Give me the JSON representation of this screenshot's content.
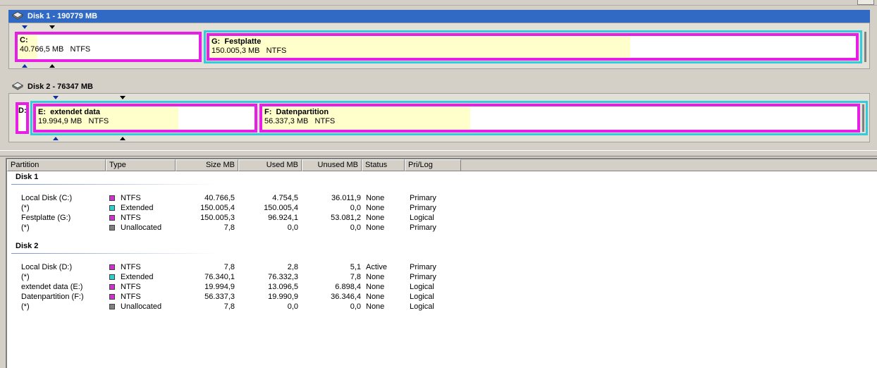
{
  "disks": [
    {
      "title": "Disk 1 - 190779 MB",
      "partitions": [
        {
          "letter": "C:",
          "name": "",
          "size": "40.766,5 MB",
          "fs": "NTFS"
        },
        {
          "letter": "G:",
          "name": "Festplatte",
          "size": "150.005,3 MB",
          "fs": "NTFS"
        }
      ]
    },
    {
      "title": "Disk 2 - 76347 MB",
      "partitions": [
        {
          "letter": "D:",
          "name": "",
          "size": "",
          "fs": ""
        },
        {
          "letter": "E:",
          "name": "extendet data",
          "size": "19.994,9 MB",
          "fs": "NTFS"
        },
        {
          "letter": "F:",
          "name": "Datenpartition",
          "size": "56.337,3 MB",
          "fs": "NTFS"
        }
      ]
    }
  ],
  "columns": [
    "Partition",
    "Type",
    "Size MB",
    "Used MB",
    "Unused MB",
    "Status",
    "Pri/Log"
  ],
  "groups": [
    {
      "title": "Disk 1",
      "rows": [
        {
          "partition": "Local Disk (C:)",
          "type": "NTFS",
          "color": "#cc33cc",
          "size": "40.766,5",
          "used": "4.754,5",
          "unused": "36.011,9",
          "status": "None",
          "prilog": "Primary"
        },
        {
          "partition": "(*)",
          "type": "Extended",
          "color": "#33cccc",
          "size": "150.005,4",
          "used": "150.005,4",
          "unused": "0,0",
          "status": "None",
          "prilog": "Primary"
        },
        {
          "partition": "Festplatte (G:)",
          "type": "NTFS",
          "color": "#cc33cc",
          "size": "150.005,3",
          "used": "96.924,1",
          "unused": "53.081,2",
          "status": "None",
          "prilog": "Logical"
        },
        {
          "partition": "(*)",
          "type": "Unallocated",
          "color": "#808080",
          "size": "7,8",
          "used": "0,0",
          "unused": "0,0",
          "status": "None",
          "prilog": "Primary"
        }
      ]
    },
    {
      "title": "Disk 2",
      "rows": [
        {
          "partition": "Local Disk (D:)",
          "type": "NTFS",
          "color": "#cc33cc",
          "size": "7,8",
          "used": "2,8",
          "unused": "5,1",
          "status": "Active",
          "prilog": "Primary"
        },
        {
          "partition": "(*)",
          "type": "Extended",
          "color": "#33cccc",
          "size": "76.340,1",
          "used": "76.332,3",
          "unused": "7,8",
          "status": "None",
          "prilog": "Primary"
        },
        {
          "partition": "extendet data (E:)",
          "type": "NTFS",
          "color": "#cc33cc",
          "size": "19.994,9",
          "used": "13.096,5",
          "unused": "6.898,4",
          "status": "None",
          "prilog": "Logical"
        },
        {
          "partition": "Datenpartition (F:)",
          "type": "NTFS",
          "color": "#cc33cc",
          "size": "56.337,3",
          "used": "19.990,9",
          "unused": "36.346,4",
          "status": "None",
          "prilog": "Logical"
        },
        {
          "partition": "(*)",
          "type": "Unallocated",
          "color": "#808080",
          "size": "7,8",
          "used": "0,0",
          "unused": "0,0",
          "status": "None",
          "prilog": "Logical"
        }
      ]
    }
  ],
  "colors": {
    "ntfs": "#e61ee6",
    "extended": "#33ccdd",
    "used_fill": "#ffffcc",
    "selection": "#316ac5"
  },
  "icons": [
    "hard-disk-icon"
  ]
}
